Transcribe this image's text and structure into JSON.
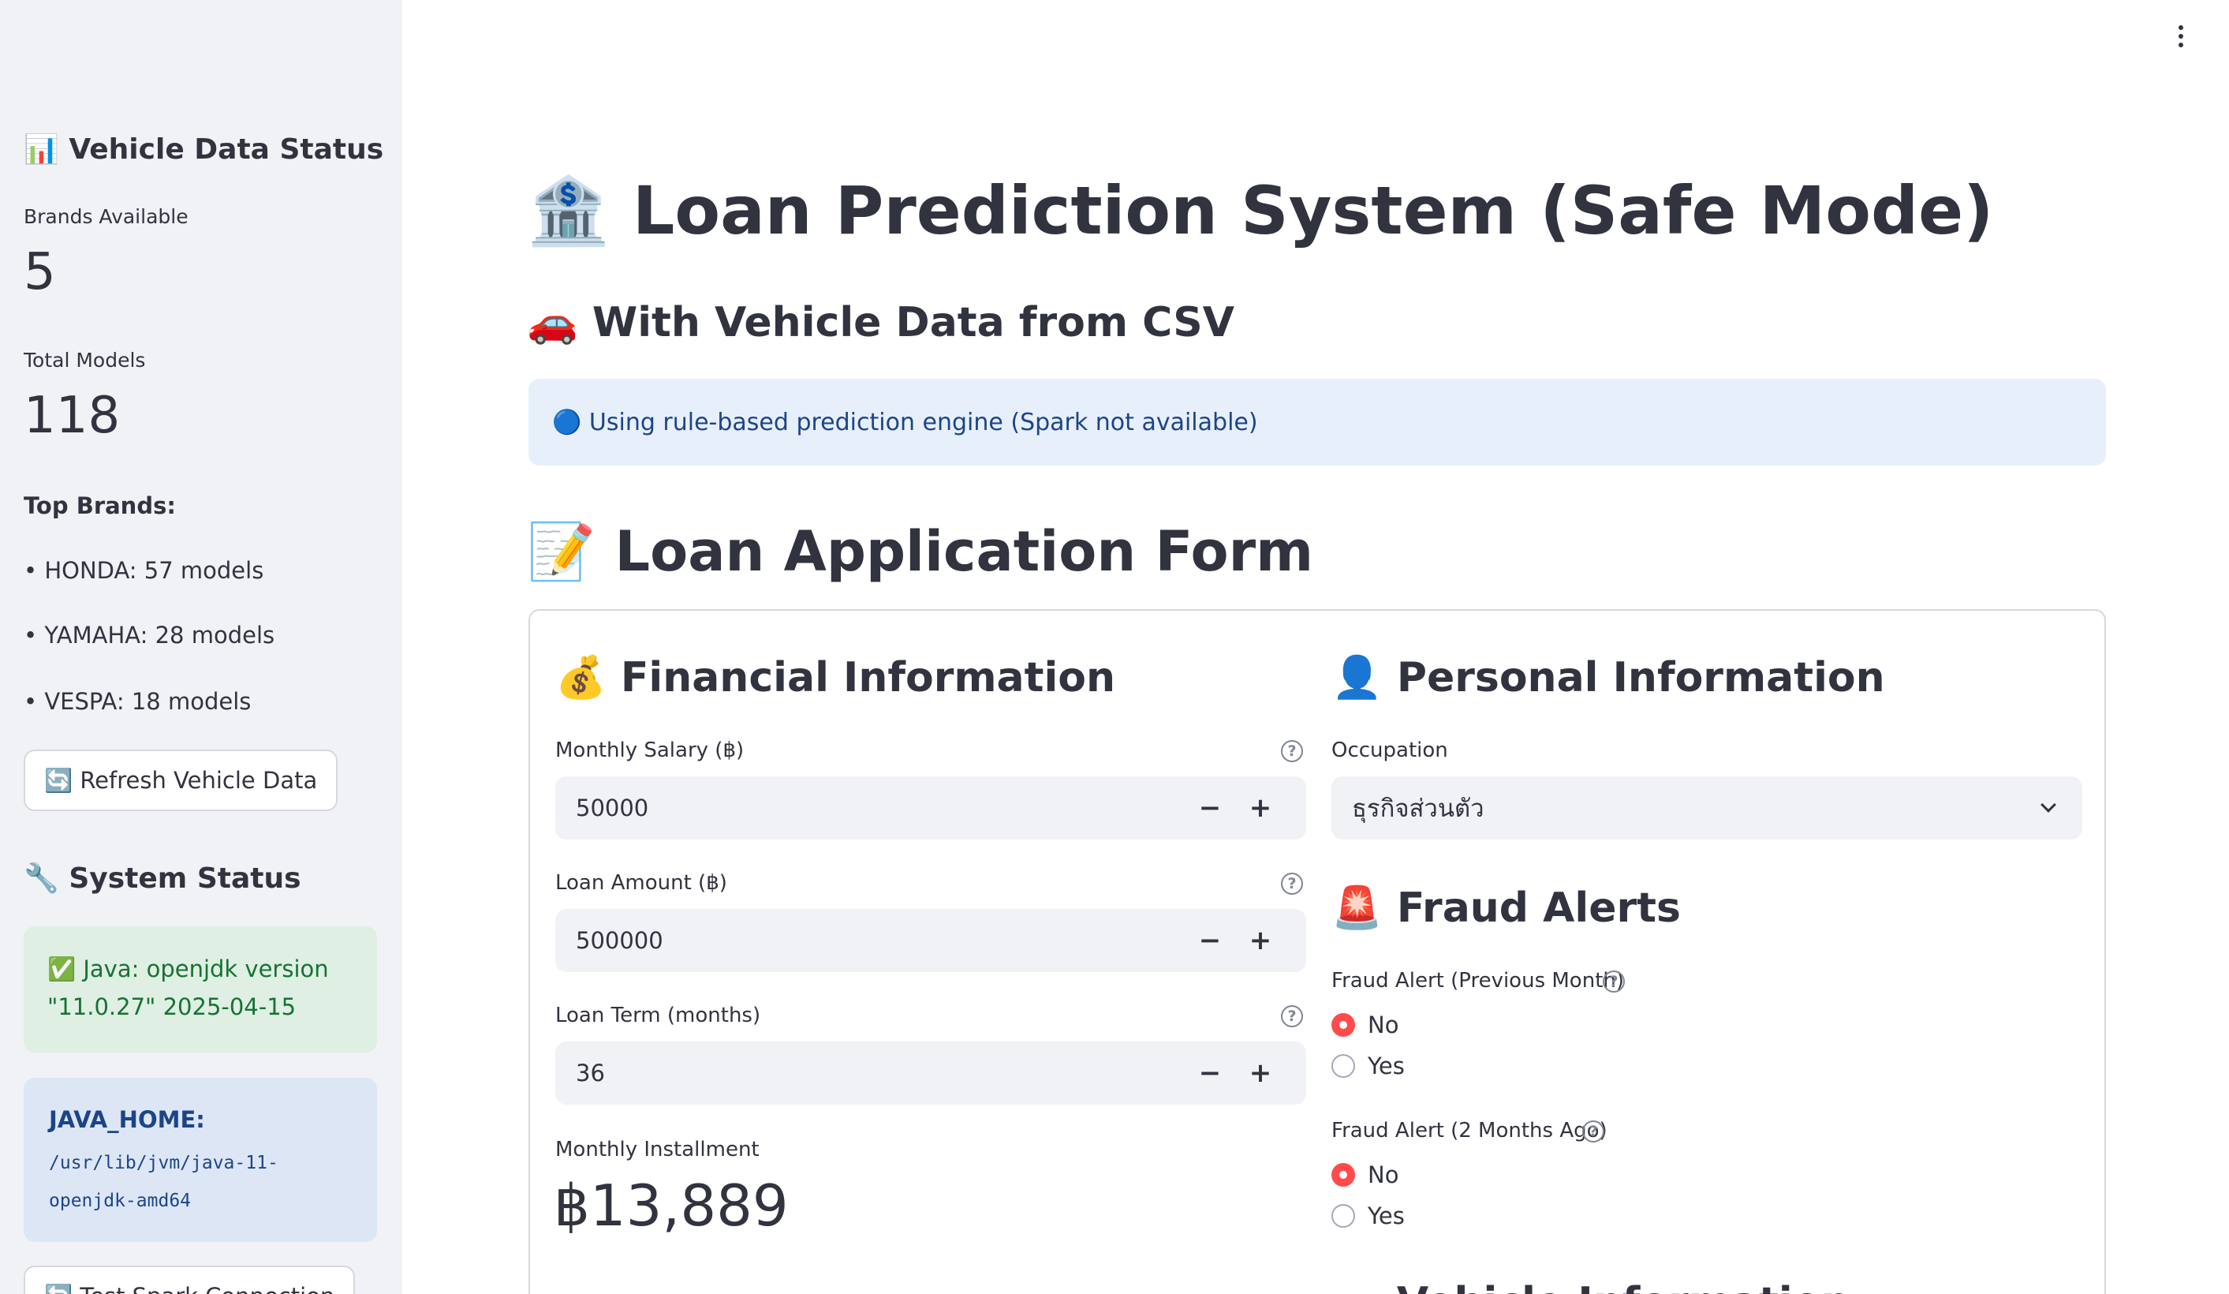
{
  "sidebar": {
    "vehicle_status_title": "📊 Vehicle Data Status",
    "brands_label": "Brands Available",
    "brands_value": "5",
    "models_label": "Total Models",
    "models_value": "118",
    "top_brands_label": "Top Brands:",
    "top_brands": [
      "• HONDA: 57 models",
      "• YAMAHA: 28 models",
      "• VESPA: 18 models"
    ],
    "refresh_button": "🔄 Refresh Vehicle Data",
    "system_status_title": "🔧 System Status",
    "java_status": "✅ Java: openjdk version \"11.0.27\" 2025-04-15",
    "java_home_label": "JAVA_HOME:",
    "java_home_value": "/usr/lib/jvm/java-11-openjdk-amd64",
    "test_spark_button": "🔄 Test Spark Connection"
  },
  "main": {
    "title": "🏦 Loan Prediction System (Safe Mode)",
    "subtitle": "🚗 With Vehicle Data from CSV",
    "info_banner": "🔵 Using rule-based prediction engine (Spark not available)",
    "form_title": "📝 Loan Application Form"
  },
  "form": {
    "financial": {
      "title": "💰 Financial Information",
      "salary_label": "Monthly Salary (฿)",
      "salary_value": "50000",
      "loan_amount_label": "Loan Amount (฿)",
      "loan_amount_value": "500000",
      "loan_term_label": "Loan Term (months)",
      "loan_term_value": "36",
      "installment_label": "Monthly Installment",
      "installment_value": "฿13,889",
      "minus": "−",
      "plus": "+"
    },
    "personal": {
      "title": "👤 Personal Information",
      "occupation_label": "Occupation",
      "occupation_value": "ธุรกิจส่วนตัว"
    },
    "fraud": {
      "title": "🚨 Fraud Alerts",
      "prev_month_label": "Fraud Alert (Previous Month)",
      "two_months_label": "Fraud Alert (2 Months Ago)",
      "option_no": "No",
      "option_yes": "Yes"
    },
    "vehicle": {
      "title": "🏍️ Vehicle Information"
    }
  },
  "help_glyph": "?",
  "colors": {
    "accent": "#ff4b4b",
    "info_bg": "#e7effb",
    "success_bg": "#dfefe3",
    "sidebar_bg": "#f0f2f6"
  }
}
